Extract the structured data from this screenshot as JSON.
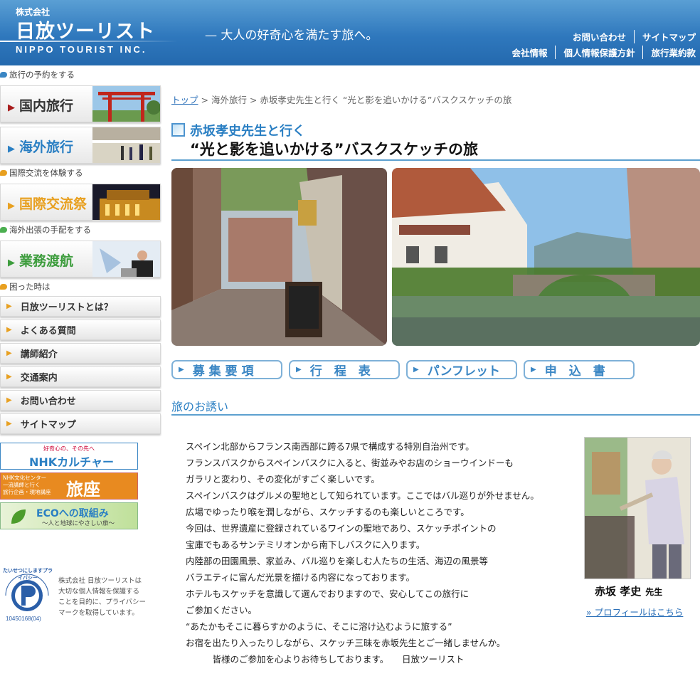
{
  "header": {
    "company_small": "株式会社",
    "company_main": "日放ツーリスト",
    "company_en": "NIPPO TOURIST INC.",
    "tagline": "— 大人の好奇心を満たす旅へ。",
    "nav_row1": [
      "お問い合わせ",
      "サイトマップ"
    ],
    "nav_row2": [
      "会社情報",
      "個人情報保護方針",
      "旅行業約款"
    ]
  },
  "sidebar": {
    "sections": [
      "旅行の予約をする",
      "国際交流を体験する",
      "海外出張の手配をする",
      "困った時は"
    ],
    "section_colors": [
      "#3a86c4",
      "#e8a020",
      "#4caf50",
      "#e8a020"
    ],
    "big_buttons": [
      {
        "label": "国内旅行",
        "color": "#a81c1c"
      },
      {
        "label": "海外旅行",
        "color": "#2a7fc3"
      },
      {
        "label": "国際交流祭",
        "color": "#e8a020"
      },
      {
        "label": "業務渡航",
        "color": "#3c9c3c"
      }
    ],
    "small_buttons": [
      "日放ツーリストとは？",
      "よくある質問",
      "講師紹介",
      "交通案内",
      "お問い合わせ",
      "サイトマップ"
    ],
    "banners": {
      "nhk_top": "好奇心の、その先へ",
      "nhk_main": "NHKカルチャー",
      "tabiza_left": "NHK文化センター\n一流講師と行く\n旅行企画・現地講座",
      "tabiza_main": "旅座",
      "eco_main": "ECOへの取組み",
      "eco_sub": "〜人と地球にやさしい旅〜"
    },
    "privacy": {
      "text": "株式会社 日放ツーリストは\n大切な個人情報を保護する\nことを目的に、プライバシー\nマークを取得しています。",
      "number": "10450168(04)",
      "arc": "たいせつにしますプライバシー"
    }
  },
  "main": {
    "breadcrumb": {
      "home": "トップ",
      "sep": " > ",
      "overseas": "海外旅行",
      "current": "赤坂孝史先生と行く “光と影を追いかける”バスクスケッチの旅"
    },
    "title_line1": "赤坂孝史先生と行く",
    "title_line2": "“光と影を追いかける”バスクスケッチの旅",
    "tabs": [
      "募 集 要 項",
      "行　程　表",
      "パンフレット",
      "申　込　書"
    ],
    "section_title": "旅のお誘い",
    "body": [
      "スペイン北部からフランス南西部に跨る7県で構成する特別自治州です。",
      "フランスバスクからスペインバスクに入ると、街並みやお店のショーウインドーも",
      "ガラリと変わり、その変化がすごく楽しいです。",
      "スペインバスクはグルメの聖地として知られています。ここではバル巡りが外せません。",
      "広場でゆったり喉を潤しながら、スケッチするのも楽しいところです。",
      "今回は、世界遺産に登録されているワインの聖地であり、スケッチポイントの",
      "宝庫でもあるサンテミリオンから南下しバスクに入ります。",
      "内陸部の田園風景、家並み、バル巡りを楽しむ人たちの生活、海辺の風景等",
      "バラエティに富んだ光景を描ける内容になっております。",
      "ホテルもスケッチを意識して選んでおりますので、安心してこの旅行に",
      "ご参加ください。",
      "“あたかもそこに暮らすかのように、そこに溶け込むように旅する”",
      "お宿を出たり入ったりしながら、スケッチ三昧を赤坂先生とご一緒しませんか。",
      "　　　皆様のご参加を心よりお待ちしております。　　日放ツーリスト"
    ],
    "profile": {
      "name": "赤坂 孝史",
      "title": "先生",
      "link": "» プロフィールはこちら"
    }
  }
}
